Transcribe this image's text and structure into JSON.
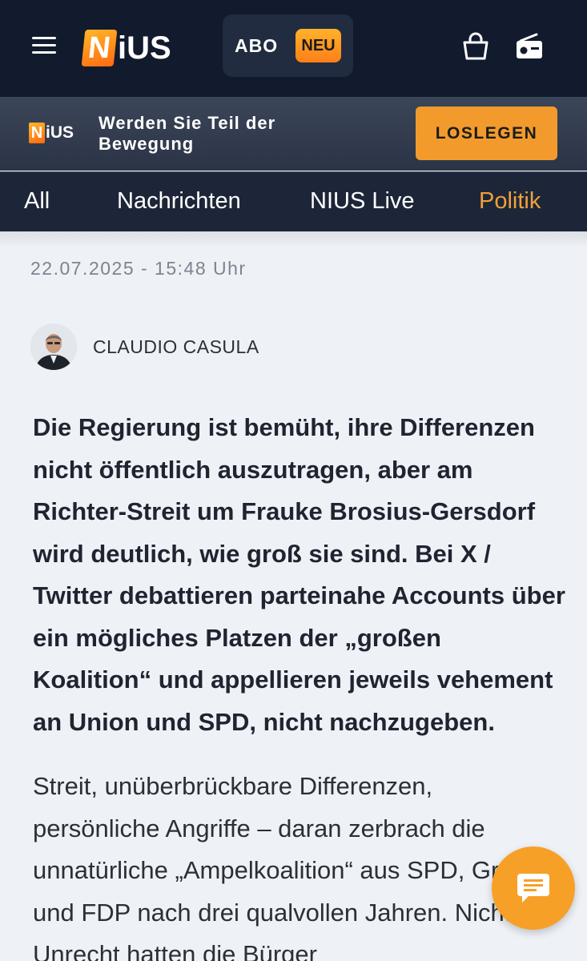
{
  "header": {
    "logo_initial": "N",
    "logo_rest": "iUS",
    "abo_label": "ABO",
    "neu_badge": "NEU"
  },
  "promo": {
    "logo_initial": "N",
    "logo_rest": "iUS",
    "text": "Werden Sie Teil der Bewegung",
    "button_label": "LOSLEGEN"
  },
  "nav": {
    "items": [
      {
        "label": "All"
      },
      {
        "label": "Nachrichten"
      },
      {
        "label": "NIUS Live"
      },
      {
        "label": "Politik"
      }
    ],
    "active": "Politik"
  },
  "article": {
    "date": "22.07.2025 - 15:48 Uhr",
    "author": "CLAUDIO CASULA",
    "lead": "Die Regierung ist bemüht, ihre Differenzen nicht öffentlich auszutragen, aber am Richter-Streit um Frauke Brosius-Gersdorf wird deutlich, wie groß sie sind. Bei X / Twitter debattieren parteinahe Accounts über ein mögliches Platzen der „großen Koalition“ und appellieren jeweils vehement an Union und SPD, nicht nachzugeben.",
    "body": "Streit, unüberbrückbare Differenzen, persönliche Angriffe – daran zerbrach die unnatürliche „Ampelkoalition“ aus SPD, Grünen und FDP nach drei qualvollen Jahren. Nicht zu Unrecht hatten die Bürger"
  },
  "colors": {
    "header_bg": "#121a2d",
    "accent_orange": "#f29b2c",
    "nav_active": "#f0a03b",
    "page_bg": "#eef1f6"
  },
  "icons": {
    "menu": "hamburger-menu-icon",
    "bag": "shopping-bag-icon",
    "radio": "radio-icon",
    "chat": "chat-bubble-icon"
  }
}
